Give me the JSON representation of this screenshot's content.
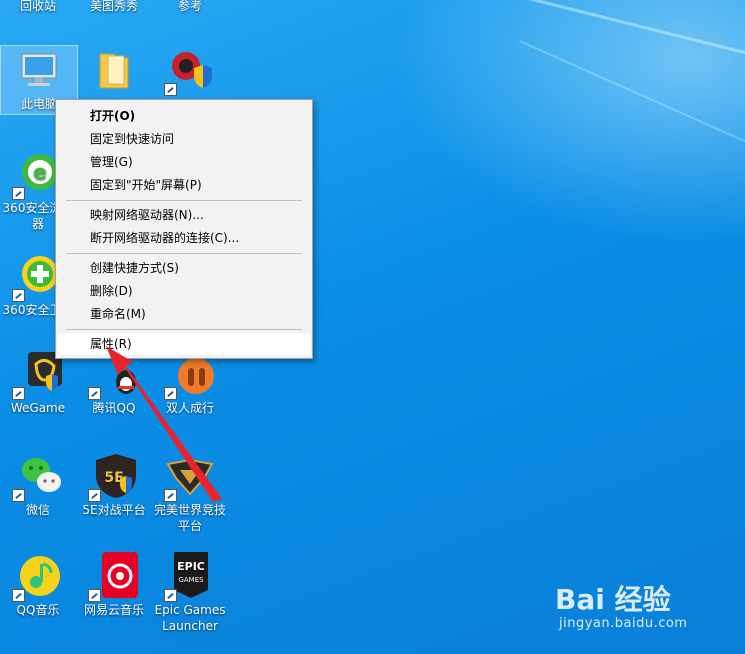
{
  "desktop": {
    "top_labels": [
      "回收站",
      "美图秀秀",
      "参考"
    ],
    "icons": [
      {
        "label": "此电脑",
        "icon": "computer-icon"
      },
      {
        "label": "",
        "icon": "folder-icon"
      },
      {
        "label": "",
        "icon": "game-shield-icon"
      },
      {
        "label": "360安全浏览器",
        "icon": "browser-360-icon"
      },
      {
        "label": "360安全卫士",
        "icon": "security-360-icon"
      },
      {
        "label": "WeGame",
        "icon": "wegame-icon"
      },
      {
        "label": "腾讯QQ",
        "icon": "qq-icon"
      },
      {
        "label": "双人成行",
        "icon": "it-takes-two-icon"
      },
      {
        "label": "微信",
        "icon": "wechat-icon"
      },
      {
        "label": "5E对战平台",
        "icon": "5e-platform-icon"
      },
      {
        "label": "完美世界竞技平台",
        "icon": "perfect-world-icon"
      },
      {
        "label": "QQ音乐",
        "icon": "qq-music-icon"
      },
      {
        "label": "网易云音乐",
        "icon": "netease-music-icon"
      },
      {
        "label": "Epic Games Launcher",
        "icon": "epic-games-icon"
      }
    ],
    "icon_texts": {
      "epic_line1": "EPIC",
      "epic_line2": "GAMES",
      "fivee": "5E"
    }
  },
  "context_menu": {
    "items": [
      {
        "label": "打开(O)"
      },
      {
        "label": "固定到快速访问"
      },
      {
        "label": "管理(G)"
      },
      {
        "label": "固定到\"开始\"屏幕(P)"
      },
      {
        "label": "映射网络驱动器(N)..."
      },
      {
        "label": "断开网络驱动器的连接(C)..."
      },
      {
        "label": "创建快捷方式(S)"
      },
      {
        "label": "删除(D)"
      },
      {
        "label": "重命名(M)"
      },
      {
        "label": "属性(R)"
      }
    ],
    "highlighted": "属性(R)"
  },
  "watermark": {
    "brand": "Bai 经验",
    "url": "jingyan.baidu.com"
  },
  "colors": {
    "desktop": "#0a8fe8",
    "menu_bg": "#f2f2f2",
    "arrow": "#e8232a"
  }
}
